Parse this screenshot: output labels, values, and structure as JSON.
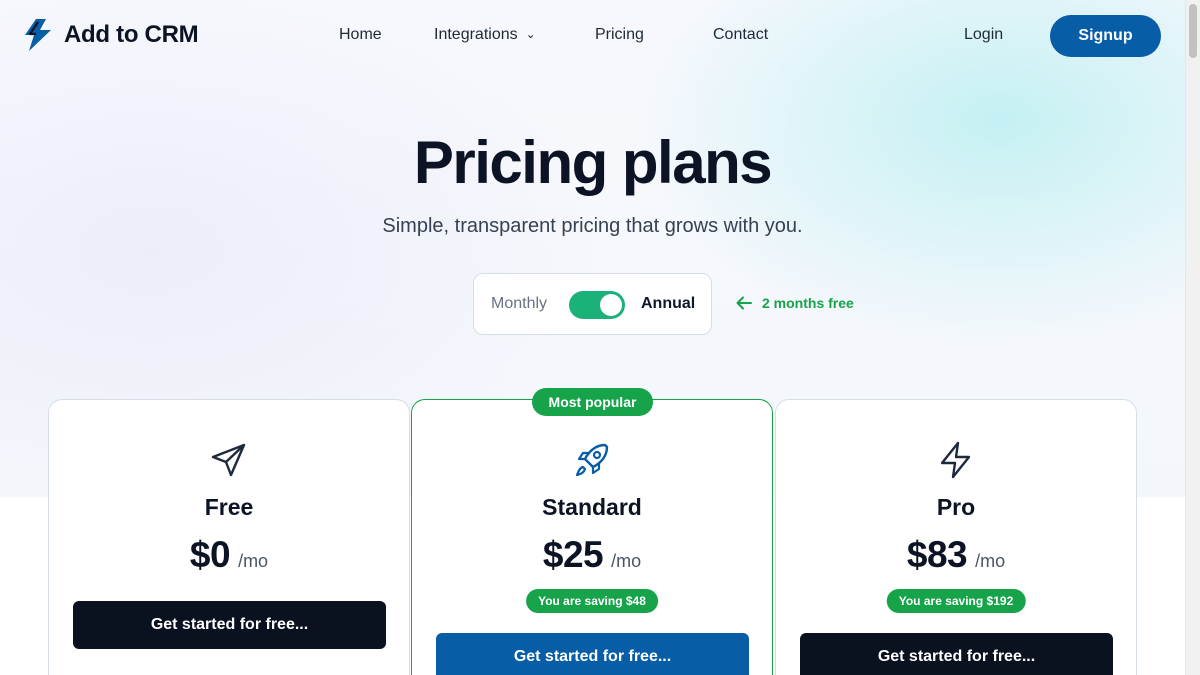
{
  "brand": {
    "name": "Add to CRM",
    "icon": "bolt-logo-icon",
    "color": "#075da6"
  },
  "nav": {
    "links": [
      "Home",
      "Integrations",
      "Pricing",
      "Contact"
    ],
    "integrations_icon": "chevron-down-icon",
    "login": "Login",
    "signup": "Signup"
  },
  "hero": {
    "title": "Pricing plans",
    "subtitle": "Simple, transparent pricing that grows with you."
  },
  "billing_toggle": {
    "monthly": "Monthly",
    "annual": "Annual",
    "selected": "Annual",
    "promo": "2 months free",
    "promo_icon": "arrow-left-icon"
  },
  "plans": [
    {
      "name": "Free",
      "price": "$0",
      "per": "/mo",
      "icon": "paper-plane-icon",
      "cta": "Get started for free...",
      "saving": null,
      "highlight": false
    },
    {
      "name": "Standard",
      "price": "$25",
      "per": "/mo",
      "icon": "rocket-icon",
      "cta": "Get started for free...",
      "saving": "You are saving $48",
      "highlight": true,
      "badge": "Most popular"
    },
    {
      "name": "Pro",
      "price": "$83",
      "per": "/mo",
      "icon": "lightning-icon",
      "cta": "Get started for free...",
      "saving": "You are saving $192",
      "highlight": false
    }
  ],
  "colors": {
    "primary": "#075da6",
    "accent_green": "#16a34a",
    "toggle_green": "#1bb27a",
    "dark": "#0a1220"
  }
}
